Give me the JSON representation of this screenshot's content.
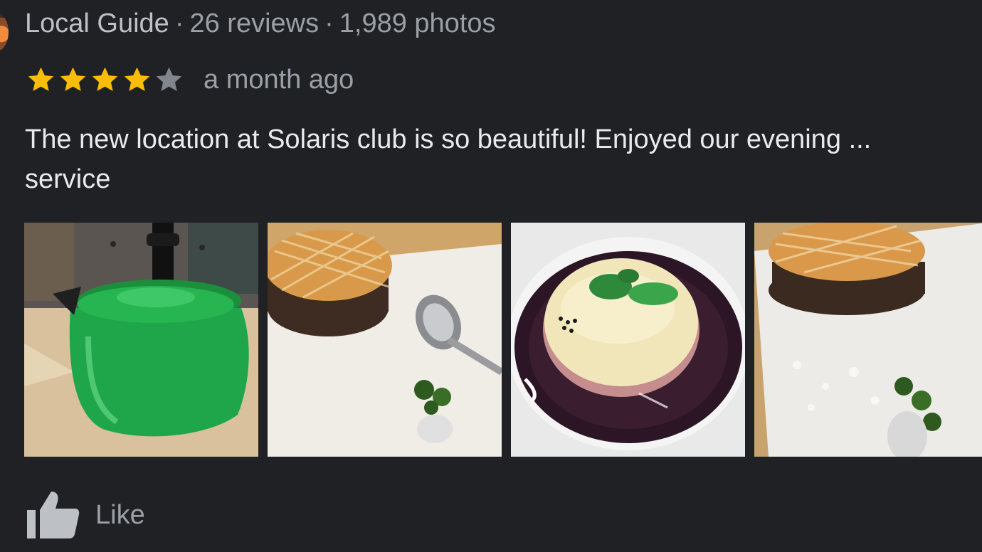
{
  "review": {
    "reviewer_type": "Local Guide",
    "review_count": "26 reviews",
    "photo_count": "1,989 photos",
    "separator": "·",
    "rating": 4,
    "rating_max": 5,
    "time_ago": "a month ago",
    "text_line1": "The new location at Solaris club is so beautiful! Enjoyed our evening ...",
    "text_line2": "service",
    "photos": [
      {
        "icon": "green-teapot-photo"
      },
      {
        "icon": "caramel-tart-with-spoon-photo"
      },
      {
        "icon": "panna-cotta-berry-sauce-photo"
      },
      {
        "icon": "caramel-tart-photo"
      }
    ]
  },
  "actions": {
    "like_label": "Like"
  },
  "colors": {
    "background": "#202124",
    "star_filled": "#fbbc04",
    "star_empty": "#80868b",
    "text_primary": "#e8eaed",
    "text_secondary": "#9aa0a6"
  }
}
